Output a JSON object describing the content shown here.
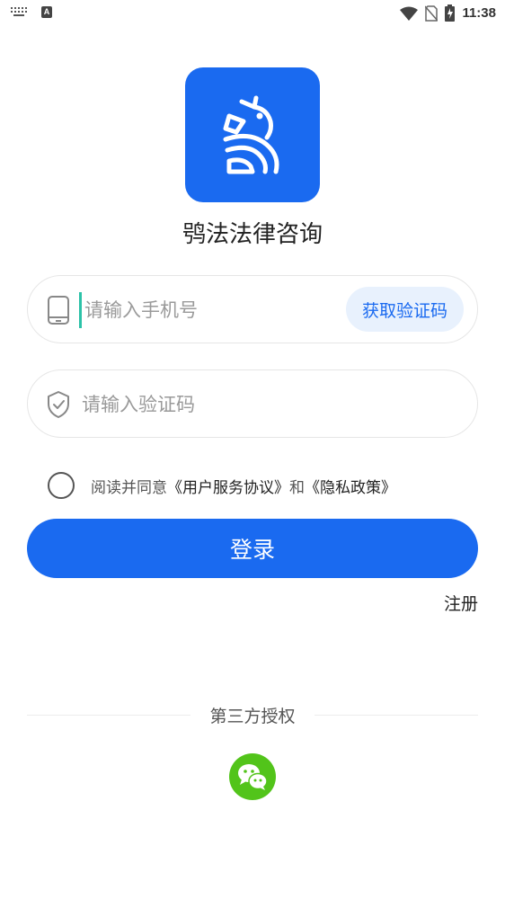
{
  "status_bar": {
    "time": "11:38",
    "icons": [
      "keyboard-icon",
      "a-notification-icon",
      "wifi-icon",
      "no-sim-icon",
      "battery-charging-icon"
    ]
  },
  "app": {
    "name": "鸮法法律咨询"
  },
  "phone_field": {
    "placeholder": "请输入手机号",
    "value": ""
  },
  "get_code": {
    "label": "获取验证码"
  },
  "code_field": {
    "placeholder": "请输入验证码",
    "value": ""
  },
  "agreement": {
    "checked": false,
    "prefix": "阅读并同意",
    "user_agreement": "《用户服务协议》",
    "conjunction": "和",
    "privacy_policy": "《隐私政策》"
  },
  "login": {
    "label": "登录"
  },
  "register": {
    "label": "注册"
  },
  "third_party": {
    "label": "第三方授权",
    "providers": [
      "wechat"
    ]
  },
  "colors": {
    "brand": "#1a6af0",
    "wechat": "#52c41a",
    "cursor": "#2cc2a8"
  }
}
